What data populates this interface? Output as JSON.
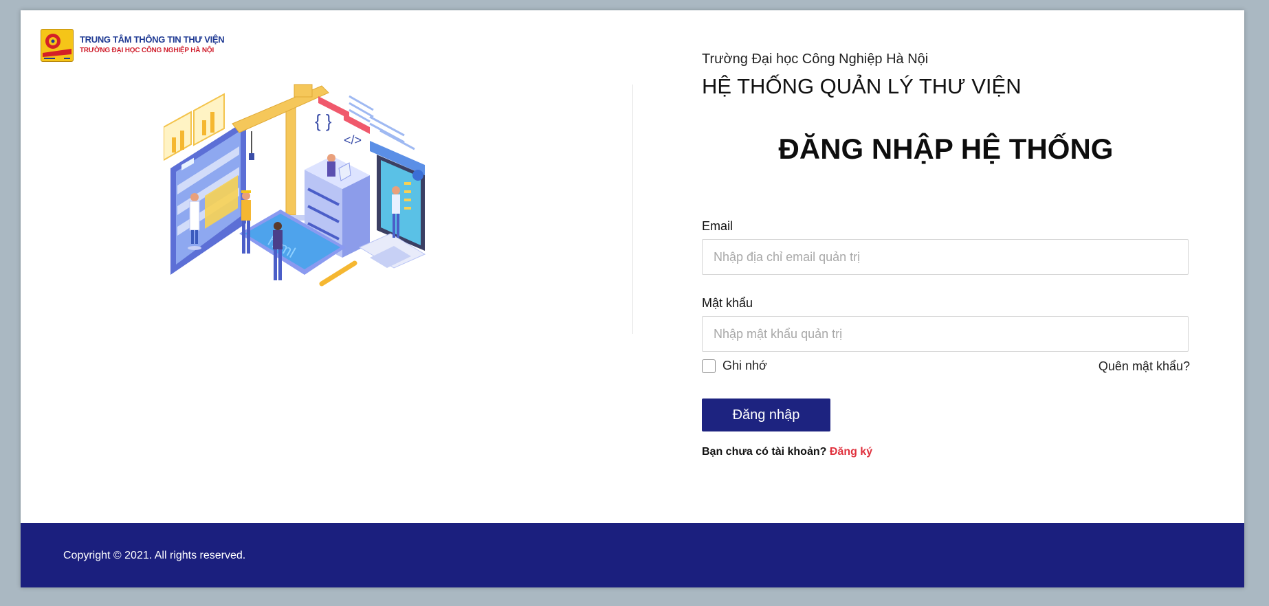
{
  "brand": {
    "line1": "TRUNG TÂM THÔNG TIN THƯ VIỆN",
    "line2": "TRƯỜNG ĐẠI HỌC CÔNG NGHIỆP HÀ NỘI"
  },
  "header": {
    "university": "Trường Đại học Công Nghiệp Hà Nội",
    "system": "HỆ THỐNG QUẢN LÝ THƯ VIỆN"
  },
  "login": {
    "title": "ĐĂNG NHẬP HỆ THỐNG",
    "email_label": "Email",
    "email_placeholder": "Nhập địa chỉ email quản trị",
    "email_value": "",
    "password_label": "Mật khẩu",
    "password_placeholder": "Nhập mật khẩu quản trị",
    "password_value": "",
    "remember_label": "Ghi nhớ",
    "remember_checked": false,
    "forgot_label": "Quên mật khẩu?",
    "submit_label": "Đăng nhập",
    "register_prompt": "Bạn chưa có tài khoản?",
    "register_link": "Đăng ký"
  },
  "illustration": {
    "icon": "it-construction-isometric-illustration",
    "overlay_text": "html"
  },
  "footer": {
    "copyright": "Copyright © 2021. All rights reserved."
  },
  "colors": {
    "accent": "#1d2380",
    "footer": "#1b1f7e",
    "link": "#e0323e",
    "background": "#aab8c2",
    "brand_blue": "#1f3a93",
    "brand_red": "#d0202e",
    "logo_yellow": "#f5c518"
  }
}
